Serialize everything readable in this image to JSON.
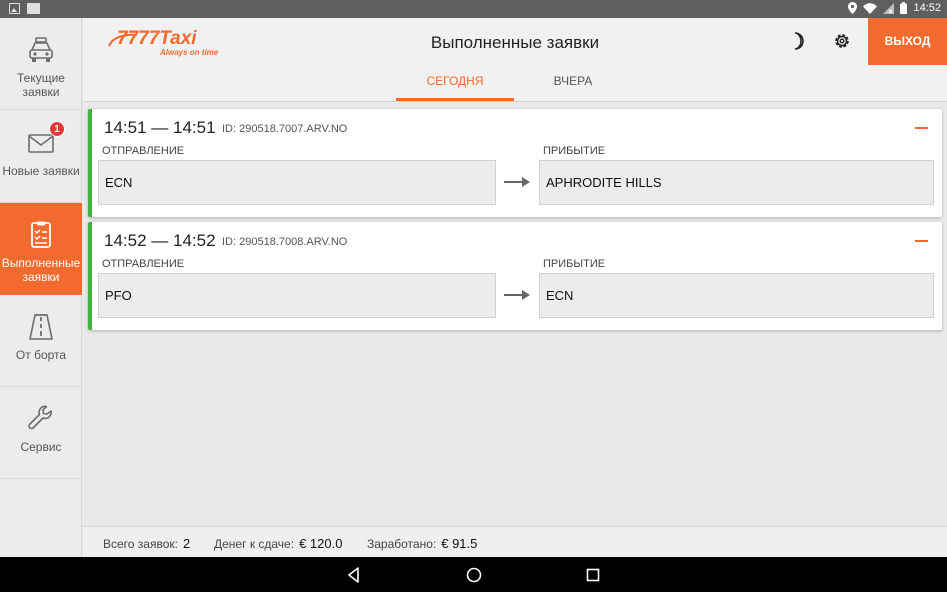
{
  "status_bar": {
    "time": "14:52"
  },
  "app": {
    "logo_text": "7777Taxi",
    "logo_tagline": "Always on time",
    "page_title": "Выполненные заявки",
    "logout_label": "ВЫХОД"
  },
  "sidebar": {
    "items": [
      {
        "label": "Текущие заявки",
        "icon": "taxi-icon"
      },
      {
        "label": "Новые заявки",
        "icon": "envelope-icon",
        "badge": "1"
      },
      {
        "label": "Выполненные заявки",
        "icon": "checklist-icon"
      },
      {
        "label": "От борта",
        "icon": "road-icon"
      },
      {
        "label": "Сервис",
        "icon": "wrench-icon"
      }
    ]
  },
  "tabs": [
    {
      "label": "СЕГОДНЯ"
    },
    {
      "label": "ВЧЕРА"
    }
  ],
  "orders": [
    {
      "times": "14:51 — 14:51",
      "id": "ID: 290518.7007.ARV.NO",
      "from_label": "ОТПРАВЛЕНИЕ",
      "to_label": "ПРИБЫТИЕ",
      "from": "ECN",
      "to": "APHRODITE HILLS"
    },
    {
      "times": "14:52 — 14:52",
      "id": "ID: 290518.7008.ARV.NO",
      "from_label": "ОТПРАВЛЕНИЕ",
      "to_label": "ПРИБЫТИЕ",
      "from": "PFO",
      "to": "ECN"
    }
  ],
  "footer": {
    "total_label": "Всего заявок:",
    "total_value": "2",
    "change_label": "Денег к сдаче:",
    "change_value": "€ 120.0",
    "earned_label": "Заработано:",
    "earned_value": "€ 91.5"
  },
  "colors": {
    "accent": "#f26a2e",
    "status_green": "#3db33d"
  }
}
